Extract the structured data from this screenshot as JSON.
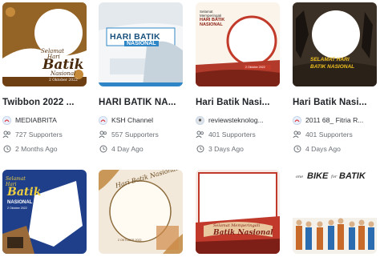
{
  "cards": [
    {
      "title": "Twibbon 2022 ...",
      "author": "MEDIABRITA",
      "supporters": "727 Supporters",
      "time": "2 Months Ago",
      "art_lines": [
        "Selamat",
        "Hari",
        "Batik",
        "Nasional",
        "2 Oktober 2022"
      ]
    },
    {
      "title": "HARI BATIK NA...",
      "author": "KSH Channel",
      "supporters": "557 Supporters",
      "time": "4 Day Ago",
      "art_lines": [
        "HARI BATIK",
        "NASIONAL"
      ]
    },
    {
      "title": "Hari Batik Nasi...",
      "author": "reviewsteknolog...",
      "supporters": "401 Supporters",
      "time": "3 Days Ago",
      "art_lines": [
        "Selamat",
        "Memperingati",
        "HARI BATIK",
        "NASIONAL",
        "2 Oktober 2022"
      ]
    },
    {
      "title": "Hari Batik Nasi...",
      "author": "2011 68_ Fitria R...",
      "supporters": "401 Supporters",
      "time": "4 Days Ago",
      "art_lines": [
        "SELAMAT HARI",
        "BATIK NASIONAL"
      ]
    },
    {
      "art_lines": [
        "Selamat",
        "Hari",
        "Batik",
        "NASIONAL",
        "2 Oktober 2022"
      ]
    },
    {
      "art_lines": [
        "Hari Batik Nasional",
        "2 OKTOBER 2022"
      ]
    },
    {
      "art_lines": [
        "Selamat Memperingati",
        "Batik Nasional"
      ]
    },
    {
      "art_lines": [
        "one",
        "BIKE",
        "for",
        "BATIK"
      ]
    }
  ],
  "colors": {
    "accent": "#e03a3e",
    "meta_grey": "#6a7076"
  }
}
